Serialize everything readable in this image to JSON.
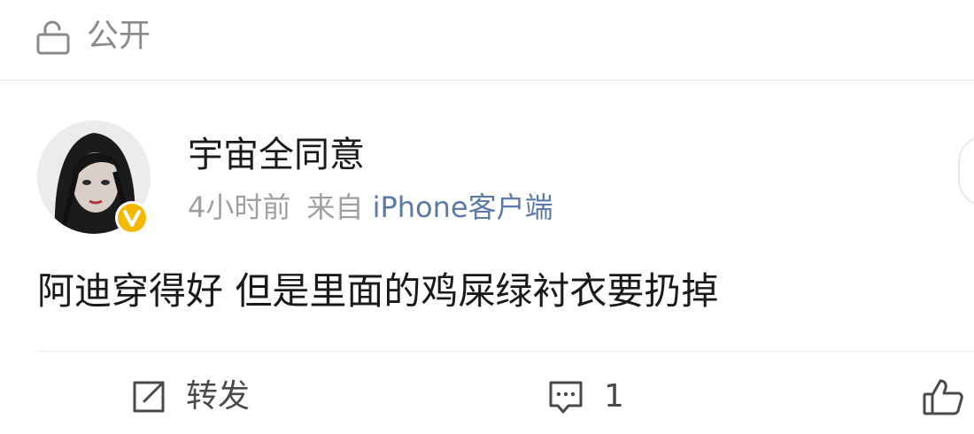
{
  "privacy": {
    "icon": "unlock-icon",
    "label": "公开"
  },
  "post": {
    "author": {
      "name": "宇宙全同意",
      "avatar_icon": "avatar",
      "verified_icon": "verified-badge-icon",
      "badge_color": "#f5b800"
    },
    "time": "4小时前",
    "source_prefix": "来自",
    "source_device": "iPhone客户端",
    "source_color": "#5b7aa8",
    "text": "阿迪穿得好 但是里面的鸡屎绿衬衣要扔掉"
  },
  "actions": {
    "repost": {
      "icon": "repost-icon",
      "label": "转发"
    },
    "comment": {
      "icon": "comment-icon",
      "count": "1"
    },
    "like": {
      "icon": "thumbs-up-icon"
    }
  }
}
